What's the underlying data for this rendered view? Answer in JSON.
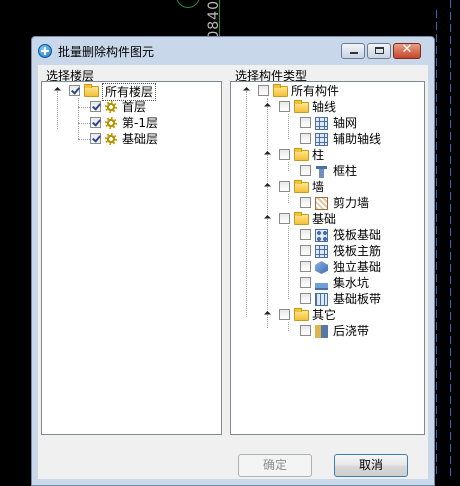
{
  "background": {
    "cad_label": "0840"
  },
  "dialog": {
    "title": "批量删除构件图元",
    "floors_label": "选择楼层",
    "types_label": "选择构件类型",
    "floors": {
      "root": "所有楼层",
      "items": [
        {
          "label": "首层",
          "checked": true
        },
        {
          "label": "第-1层",
          "checked": true
        },
        {
          "label": "基础层",
          "checked": true
        }
      ]
    },
    "types": {
      "root": "所有构件",
      "groups": [
        {
          "label": "轴线",
          "children": [
            {
              "label": "轴网",
              "icon": "axis-grid-icon"
            },
            {
              "label": "辅助轴线",
              "icon": "auxiliary-axis-icon"
            }
          ]
        },
        {
          "label": "柱",
          "children": [
            {
              "label": "框柱",
              "icon": "frame-column-icon"
            }
          ]
        },
        {
          "label": "墙",
          "children": [
            {
              "label": "剪力墙",
              "icon": "shear-wall-icon"
            }
          ]
        },
        {
          "label": "基础",
          "children": [
            {
              "label": "筏板基础",
              "icon": "raft-foundation-icon"
            },
            {
              "label": "筏板主筋",
              "icon": "raft-rebar-icon"
            },
            {
              "label": "独立基础",
              "icon": "isolated-foundation-icon"
            },
            {
              "label": "集水坑",
              "icon": "sump-pit-icon"
            },
            {
              "label": "基础板带",
              "icon": "foundation-strip-icon"
            }
          ]
        },
        {
          "label": "其它",
          "children": [
            {
              "label": "后浇带",
              "icon": "post-cast-strip-icon"
            }
          ]
        }
      ]
    },
    "buttons": {
      "ok": "确定",
      "cancel": "取消"
    }
  }
}
